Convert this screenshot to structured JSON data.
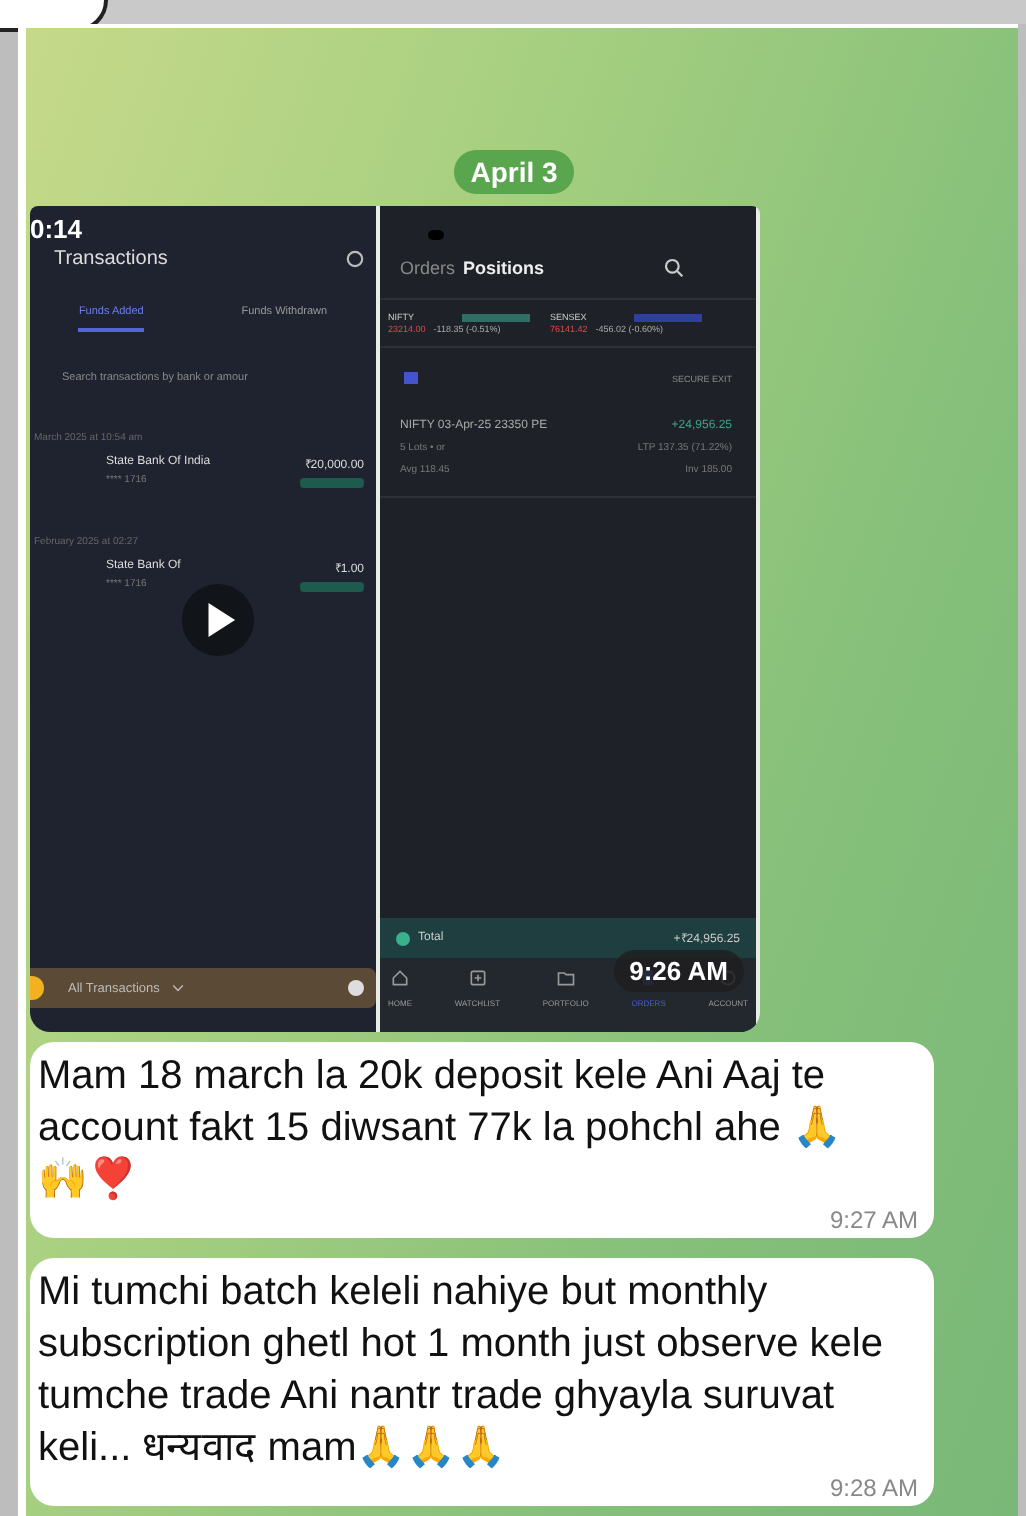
{
  "date_badge": "April 3",
  "media": {
    "time": "9:26 AM",
    "left_screen": {
      "clock": "0:14",
      "title": "Transactions",
      "tabs": [
        {
          "label": "Funds Added",
          "selected": true
        },
        {
          "label": "Funds Withdrawn",
          "selected": false
        }
      ],
      "search_placeholder": "Search transactions by bank or amour",
      "transactions": [
        {
          "date": "March 2025 at 10:54 am",
          "bank": "State Bank Of India",
          "account": "**** 1716",
          "amount": "₹20,000.00"
        },
        {
          "date": "February 2025 at 02:27",
          "bank": "State Bank Of",
          "account": "**** 1716",
          "amount": "₹1.00"
        }
      ],
      "filter": "All Transactions"
    },
    "right_screen": {
      "tabs": [
        {
          "label": "Orders",
          "selected": false
        },
        {
          "label": "Positions",
          "selected": true
        }
      ],
      "indices": [
        {
          "name": "NIFTY",
          "value": "23214.00",
          "change": "-118.35 (-0.51%)"
        },
        {
          "name": "SENSEX",
          "value": "76141.42",
          "change": "-456.02 (-0.60%)"
        }
      ],
      "secure_exit": "SECURE EXIT",
      "position": {
        "name": "NIFTY 03-Apr-25 23350 PE",
        "pnl": "+24,956.25",
        "lots": "5 Lots • or",
        "ltp": "LTP 137.35 (71.22%)",
        "avg": "Avg 118.45",
        "inv": "Inv 185.00"
      },
      "total_label": "Total",
      "total": "+₹24,956.25",
      "nav": [
        {
          "label": "HOME",
          "kind": "home",
          "selected": false
        },
        {
          "label": "WATCHLIST",
          "kind": "watchlist",
          "selected": false
        },
        {
          "label": "PORTFOLIO",
          "kind": "folder",
          "selected": false
        },
        {
          "label": "ORDERS",
          "kind": "orders",
          "selected": true
        },
        {
          "label": "ACCOUNT",
          "kind": "account",
          "selected": false
        }
      ]
    }
  },
  "messages": [
    {
      "text": "Mam 18 march la 20k deposit kele Ani Aaj te account fakt 15 diwsant 77k la pohchl ahe 🙏 🙌❣️",
      "time": "9:27 AM"
    },
    {
      "text": "Mi tumchi batch keleli nahiye but monthly subscription ghetl hot 1 month just observe kele tumche trade Ani nantr trade ghyayla suruvat keli... धन्यवाद mam🙏🙏🙏",
      "time": "9:28 AM"
    }
  ]
}
